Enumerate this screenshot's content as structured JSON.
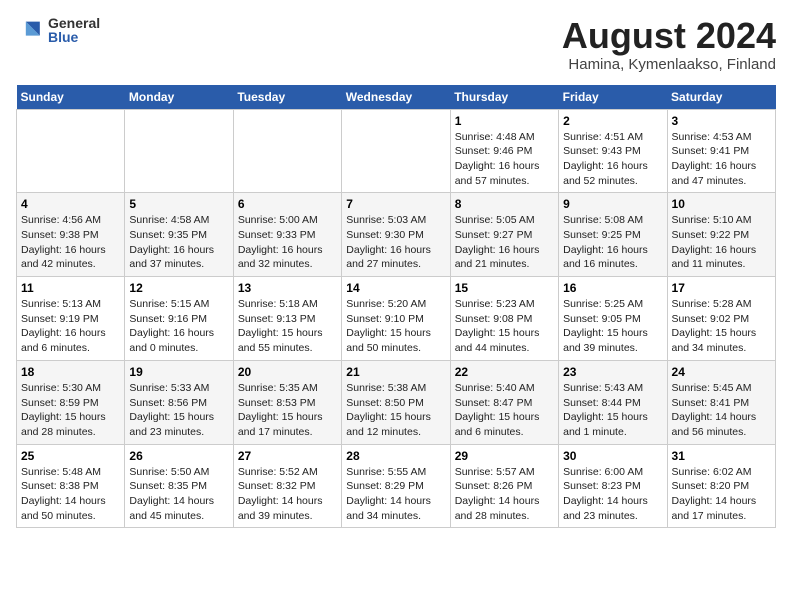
{
  "logo": {
    "general": "General",
    "blue": "Blue"
  },
  "title": "August 2024",
  "subtitle": "Hamina, Kymenlaakso, Finland",
  "weekdays": [
    "Sunday",
    "Monday",
    "Tuesday",
    "Wednesday",
    "Thursday",
    "Friday",
    "Saturday"
  ],
  "weeks": [
    [
      {
        "day": "",
        "info": ""
      },
      {
        "day": "",
        "info": ""
      },
      {
        "day": "",
        "info": ""
      },
      {
        "day": "",
        "info": ""
      },
      {
        "day": "1",
        "info": "Sunrise: 4:48 AM\nSunset: 9:46 PM\nDaylight: 16 hours and 57 minutes."
      },
      {
        "day": "2",
        "info": "Sunrise: 4:51 AM\nSunset: 9:43 PM\nDaylight: 16 hours and 52 minutes."
      },
      {
        "day": "3",
        "info": "Sunrise: 4:53 AM\nSunset: 9:41 PM\nDaylight: 16 hours and 47 minutes."
      }
    ],
    [
      {
        "day": "4",
        "info": "Sunrise: 4:56 AM\nSunset: 9:38 PM\nDaylight: 16 hours and 42 minutes."
      },
      {
        "day": "5",
        "info": "Sunrise: 4:58 AM\nSunset: 9:35 PM\nDaylight: 16 hours and 37 minutes."
      },
      {
        "day": "6",
        "info": "Sunrise: 5:00 AM\nSunset: 9:33 PM\nDaylight: 16 hours and 32 minutes."
      },
      {
        "day": "7",
        "info": "Sunrise: 5:03 AM\nSunset: 9:30 PM\nDaylight: 16 hours and 27 minutes."
      },
      {
        "day": "8",
        "info": "Sunrise: 5:05 AM\nSunset: 9:27 PM\nDaylight: 16 hours and 21 minutes."
      },
      {
        "day": "9",
        "info": "Sunrise: 5:08 AM\nSunset: 9:25 PM\nDaylight: 16 hours and 16 minutes."
      },
      {
        "day": "10",
        "info": "Sunrise: 5:10 AM\nSunset: 9:22 PM\nDaylight: 16 hours and 11 minutes."
      }
    ],
    [
      {
        "day": "11",
        "info": "Sunrise: 5:13 AM\nSunset: 9:19 PM\nDaylight: 16 hours and 6 minutes."
      },
      {
        "day": "12",
        "info": "Sunrise: 5:15 AM\nSunset: 9:16 PM\nDaylight: 16 hours and 0 minutes."
      },
      {
        "day": "13",
        "info": "Sunrise: 5:18 AM\nSunset: 9:13 PM\nDaylight: 15 hours and 55 minutes."
      },
      {
        "day": "14",
        "info": "Sunrise: 5:20 AM\nSunset: 9:10 PM\nDaylight: 15 hours and 50 minutes."
      },
      {
        "day": "15",
        "info": "Sunrise: 5:23 AM\nSunset: 9:08 PM\nDaylight: 15 hours and 44 minutes."
      },
      {
        "day": "16",
        "info": "Sunrise: 5:25 AM\nSunset: 9:05 PM\nDaylight: 15 hours and 39 minutes."
      },
      {
        "day": "17",
        "info": "Sunrise: 5:28 AM\nSunset: 9:02 PM\nDaylight: 15 hours and 34 minutes."
      }
    ],
    [
      {
        "day": "18",
        "info": "Sunrise: 5:30 AM\nSunset: 8:59 PM\nDaylight: 15 hours and 28 minutes."
      },
      {
        "day": "19",
        "info": "Sunrise: 5:33 AM\nSunset: 8:56 PM\nDaylight: 15 hours and 23 minutes."
      },
      {
        "day": "20",
        "info": "Sunrise: 5:35 AM\nSunset: 8:53 PM\nDaylight: 15 hours and 17 minutes."
      },
      {
        "day": "21",
        "info": "Sunrise: 5:38 AM\nSunset: 8:50 PM\nDaylight: 15 hours and 12 minutes."
      },
      {
        "day": "22",
        "info": "Sunrise: 5:40 AM\nSunset: 8:47 PM\nDaylight: 15 hours and 6 minutes."
      },
      {
        "day": "23",
        "info": "Sunrise: 5:43 AM\nSunset: 8:44 PM\nDaylight: 15 hours and 1 minute."
      },
      {
        "day": "24",
        "info": "Sunrise: 5:45 AM\nSunset: 8:41 PM\nDaylight: 14 hours and 56 minutes."
      }
    ],
    [
      {
        "day": "25",
        "info": "Sunrise: 5:48 AM\nSunset: 8:38 PM\nDaylight: 14 hours and 50 minutes."
      },
      {
        "day": "26",
        "info": "Sunrise: 5:50 AM\nSunset: 8:35 PM\nDaylight: 14 hours and 45 minutes."
      },
      {
        "day": "27",
        "info": "Sunrise: 5:52 AM\nSunset: 8:32 PM\nDaylight: 14 hours and 39 minutes."
      },
      {
        "day": "28",
        "info": "Sunrise: 5:55 AM\nSunset: 8:29 PM\nDaylight: 14 hours and 34 minutes."
      },
      {
        "day": "29",
        "info": "Sunrise: 5:57 AM\nSunset: 8:26 PM\nDaylight: 14 hours and 28 minutes."
      },
      {
        "day": "30",
        "info": "Sunrise: 6:00 AM\nSunset: 8:23 PM\nDaylight: 14 hours and 23 minutes."
      },
      {
        "day": "31",
        "info": "Sunrise: 6:02 AM\nSunset: 8:20 PM\nDaylight: 14 hours and 17 minutes."
      }
    ]
  ]
}
